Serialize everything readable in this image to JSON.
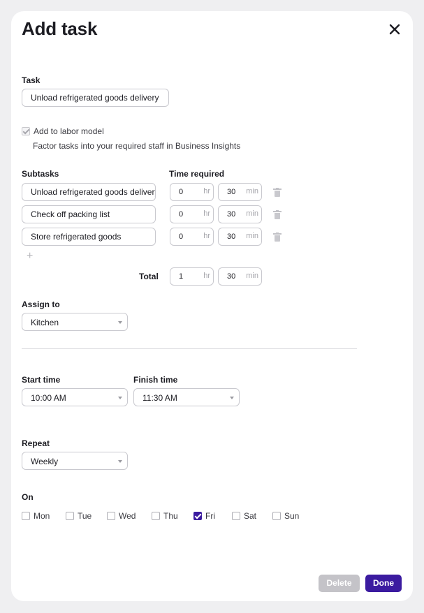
{
  "header": {
    "title": "Add task"
  },
  "task": {
    "label": "Task",
    "value": "Unload refrigerated goods delivery"
  },
  "labor": {
    "checkbox_label": "Add to labor model",
    "checked": true,
    "description": "Factor tasks into your required staff in Business Insights"
  },
  "subtasks": {
    "label": "Subtasks",
    "time_label": "Time required",
    "hr_unit": "hr",
    "min_unit": "min",
    "items": [
      {
        "name": "Unload refrigerated goods delivery",
        "hr": "0",
        "min": "30"
      },
      {
        "name": "Check off packing list",
        "hr": "0",
        "min": "30"
      },
      {
        "name": "Store refrigerated goods",
        "hr": "0",
        "min": "30"
      }
    ],
    "add_glyph": "+",
    "total_label": "Total",
    "total_hr": "1",
    "total_min": "30"
  },
  "assign": {
    "label": "Assign to",
    "value": "Kitchen"
  },
  "schedule": {
    "start_label": "Start time",
    "start_value": "10:00 AM",
    "finish_label": "Finish time",
    "finish_value": "11:30 AM"
  },
  "repeat": {
    "label": "Repeat",
    "value": "Weekly"
  },
  "on": {
    "label": "On",
    "days": [
      {
        "name": "Mon",
        "checked": false
      },
      {
        "name": "Tue",
        "checked": false
      },
      {
        "name": "Wed",
        "checked": false
      },
      {
        "name": "Thu",
        "checked": false
      },
      {
        "name": "Fri",
        "checked": true
      },
      {
        "name": "Sat",
        "checked": false
      },
      {
        "name": "Sun",
        "checked": false
      }
    ]
  },
  "footer": {
    "delete_label": "Delete",
    "done_label": "Done"
  },
  "colors": {
    "accent": "#3b1ba0",
    "delete_disabled": "#c4c3c8",
    "page_bg": "#efeff1"
  },
  "icons": {
    "close": "close-icon",
    "trash": "trash-icon",
    "add": "plus-icon",
    "caret": "chevron-down-icon"
  }
}
